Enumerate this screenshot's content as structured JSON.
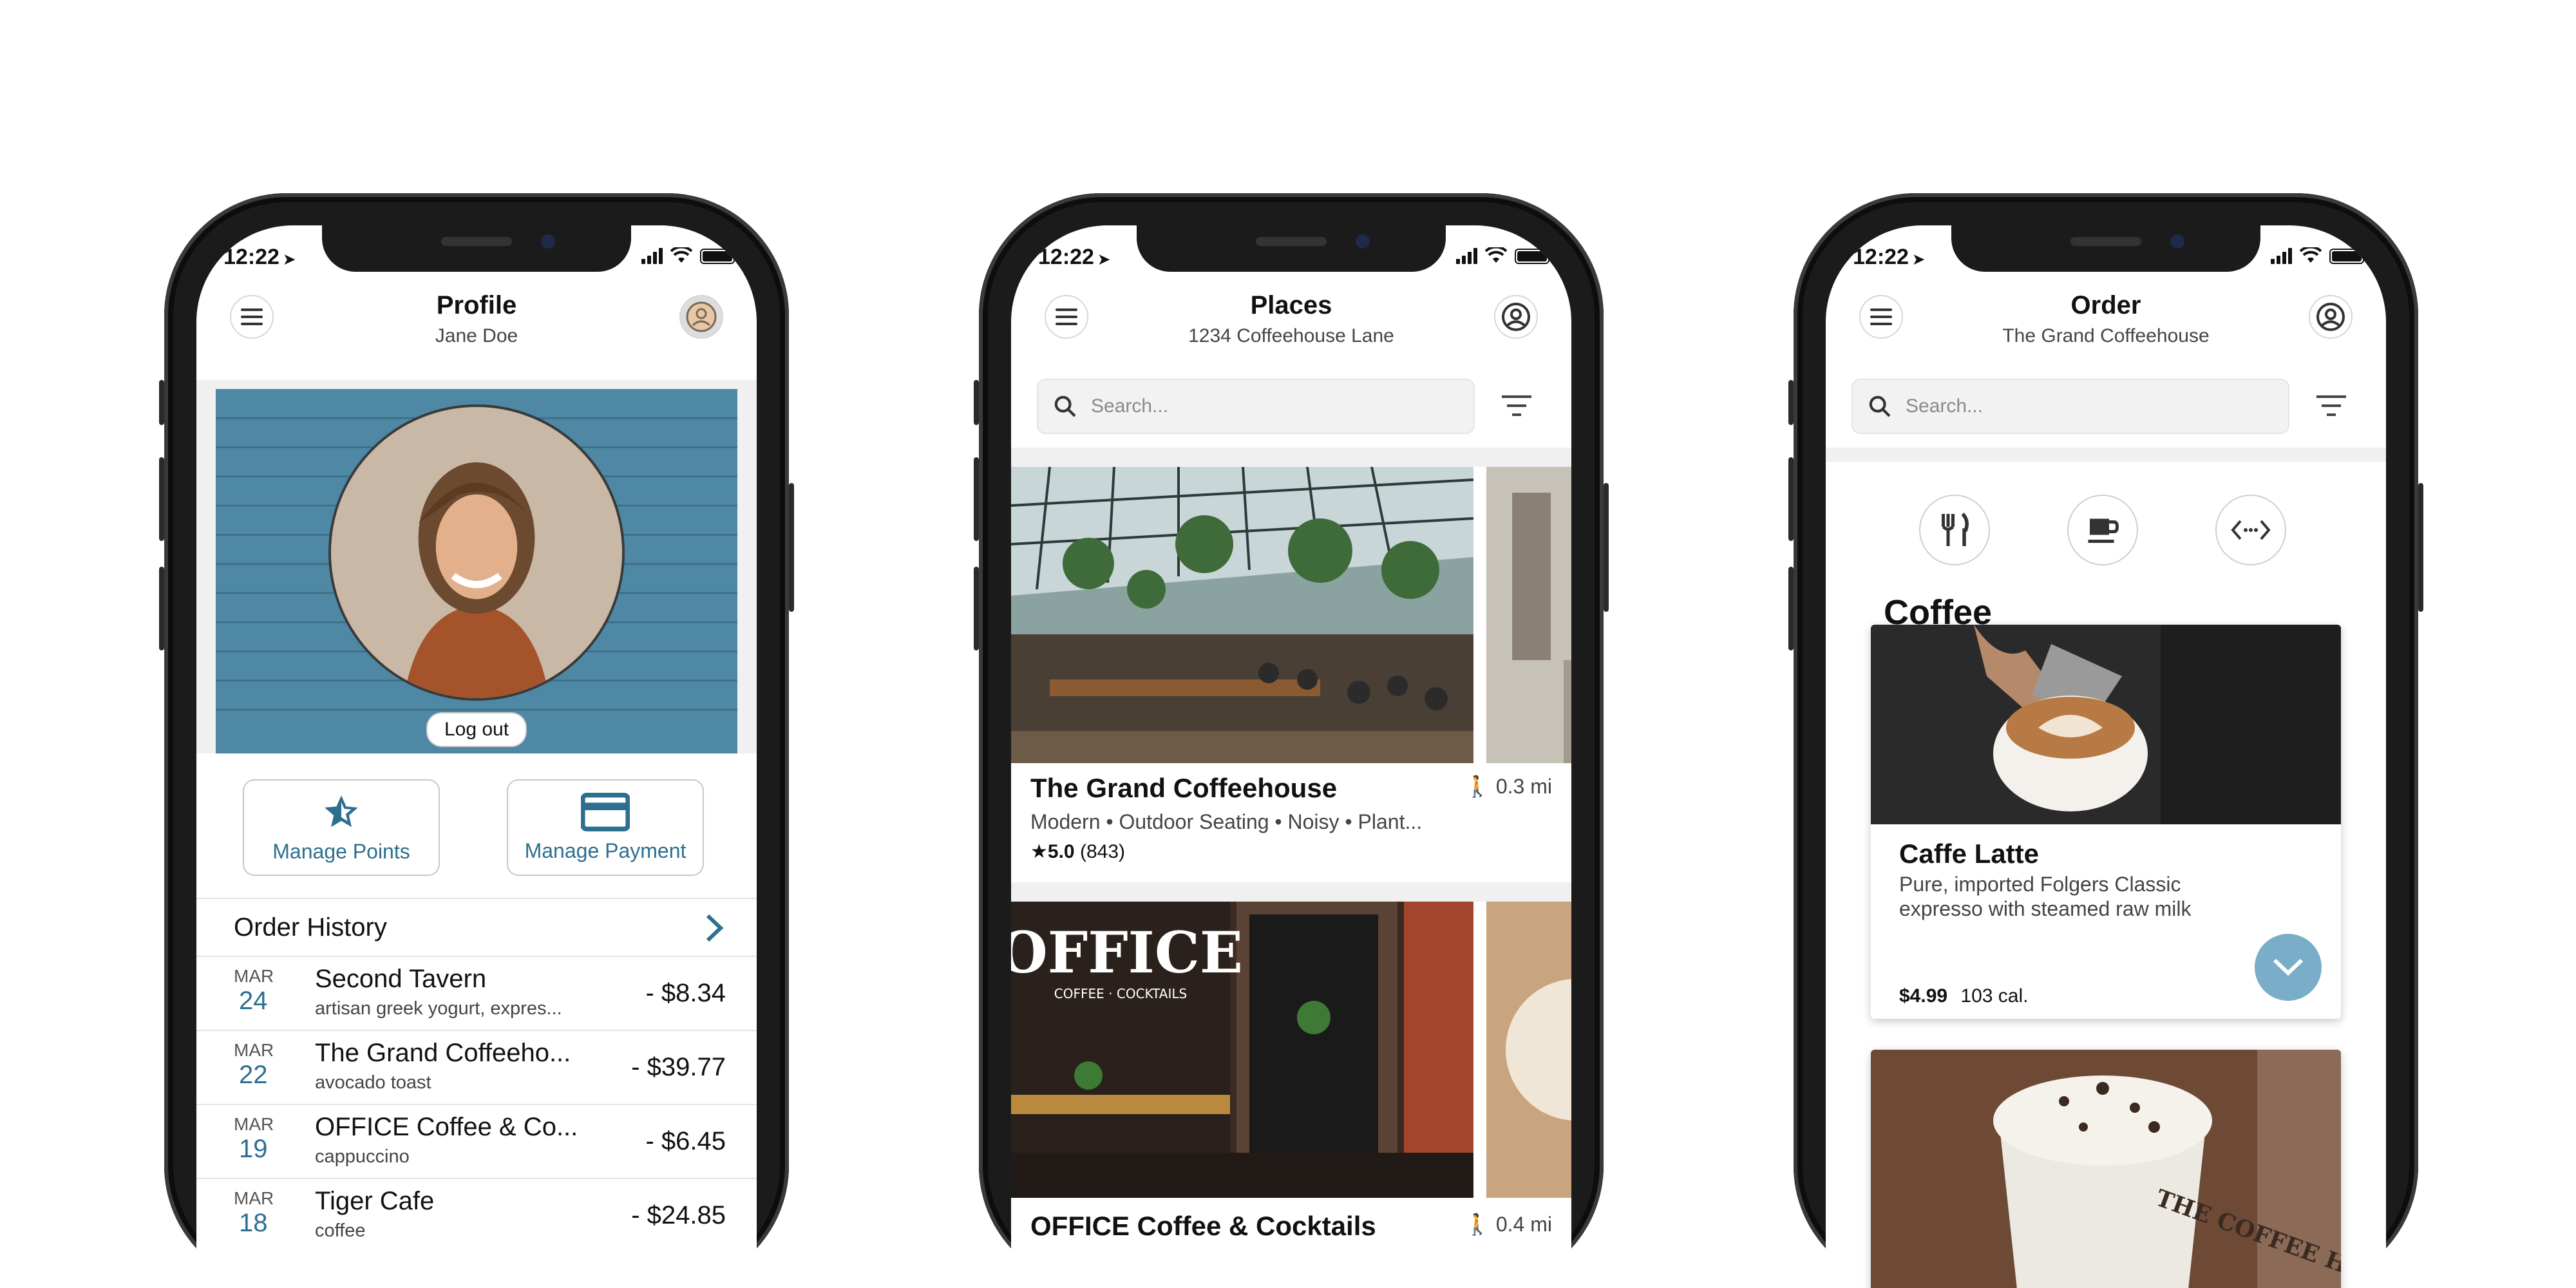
{
  "status": {
    "time": "12:22"
  },
  "profile": {
    "title": "Profile",
    "subtitle": "Jane Doe",
    "logout": "Log out",
    "actions": {
      "points": "Manage Points",
      "payment": "Manage Payment"
    },
    "order_history": "Order History",
    "orders": [
      {
        "month": "MAR",
        "day": "24",
        "name": "Second Tavern",
        "item": "artisan greek yogurt, expres...",
        "amount": "- $8.34"
      },
      {
        "month": "MAR",
        "day": "22",
        "name": "The Grand Coffeeho...",
        "item": "avocado toast",
        "amount": "- $39.77"
      },
      {
        "month": "MAR",
        "day": "19",
        "name": "OFFICE Coffee & Co...",
        "item": "cappuccino",
        "amount": "- $6.45"
      },
      {
        "month": "MAR",
        "day": "18",
        "name": "Tiger Cafe",
        "item": "coffee",
        "amount": "- $24.85"
      }
    ]
  },
  "places": {
    "title": "Places",
    "subtitle": "1234 Coffeehouse Lane",
    "search_placeholder": "Search...",
    "items": [
      {
        "name": "The Grand Coffeehouse",
        "distance": "0.3 mi",
        "tags": "Modern • Outdoor Seating • Noisy • Plant...",
        "rating": "5.0",
        "reviews": "(843)"
      },
      {
        "name": "OFFICE Coffee & Cocktails",
        "distance": "0.4 mi"
      }
    ],
    "sign_text": "OFFICE",
    "sign_sub": "COFFEE · COCKTAILS"
  },
  "order": {
    "title": "Order",
    "subtitle": "The Grand Coffeehouse",
    "search_placeholder": "Search...",
    "category_heading": "Coffee",
    "categories": [
      "food-icon",
      "coffee-cup-icon",
      "more-icon"
    ],
    "card": {
      "name": "Caffe Latte",
      "description": "Pure, imported Folgers Classic expresso with steamed raw milk",
      "price": "$4.99",
      "calories": "103 cal."
    },
    "cup_text": "THE COFFEE HOUSE"
  },
  "colors": {
    "accent": "#2d6f8f",
    "fab": "#7aaec8",
    "brick": "#4f88a4"
  }
}
